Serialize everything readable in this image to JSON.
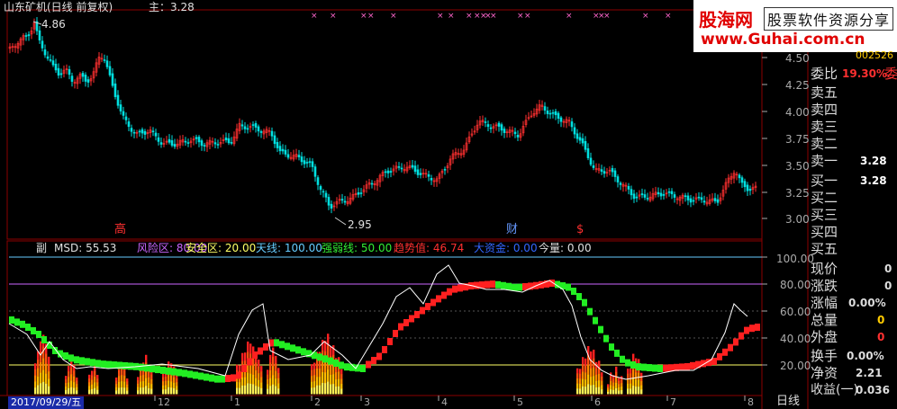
{
  "window": {
    "title": "山东矿机(日线 前复权)",
    "main_label": "主：3.28"
  },
  "price_chart": {
    "high_label": "4.86",
    "low_label": "2.95",
    "y_ticks": [
      "4.50",
      "4.25",
      "4.00",
      "3.75",
      "3.50",
      "3.25",
      "3.00"
    ],
    "markers": [
      {
        "text": "高",
        "color": "#ff3030"
      },
      {
        "text": "财",
        "color": "#6699ff"
      },
      {
        "text": "$",
        "color": "#ff3030"
      }
    ]
  },
  "indicator": {
    "prefix": "副",
    "items": [
      {
        "label": "MSD: 55.53",
        "color": "#e0e0e0"
      },
      {
        "label": "风险区: 80.00",
        "color": "#cc66ff"
      },
      {
        "label": "安全区: 20.00",
        "color": "#ffff66"
      },
      {
        "label": "天线: 100.00",
        "color": "#66ccff"
      },
      {
        "label": "强弱线: 50.00",
        "color": "#33ee33"
      },
      {
        "label": "趋势值: 46.74",
        "color": "#ff3030"
      },
      {
        "label": "大资金: 0.00",
        "color": "#3366ff"
      },
      {
        "label": "今量: 0.00",
        "color": "#e0e0e0"
      }
    ],
    "y_ticks": [
      "100.00",
      "80.00",
      "60.00",
      "40.00",
      "20.00"
    ]
  },
  "x_axis": {
    "date_badge": "2017/09/29/五",
    "ticks": [
      "1",
      "12",
      "1",
      "2",
      "3",
      "4",
      "5",
      "6",
      "7",
      "8"
    ],
    "period": "日线"
  },
  "logo": {
    "name": "股海网",
    "slogan": "股票软件资源分享",
    "url": "www.Guhai.com.cn"
  },
  "quote_panel": {
    "code": "002526",
    "ratio_label": "委比",
    "ratio_value": "19.30%",
    "ratio_suffix": "委",
    "sells": [
      "卖五",
      "卖四",
      "卖三",
      "卖二",
      "卖一"
    ],
    "sell1_price": "3.28",
    "buys": [
      "买一",
      "买二",
      "买三",
      "买四",
      "买五"
    ],
    "buy1_price": "3.28",
    "stats": [
      {
        "label": "现价",
        "value": "0"
      },
      {
        "label": "涨跌",
        "value": "0"
      },
      {
        "label": "涨幅",
        "value": "0.00%"
      },
      {
        "label": "总量",
        "value": "0"
      },
      {
        "label": "外盘",
        "value": "0"
      },
      {
        "label": "换手",
        "value": "0.00%"
      },
      {
        "label": "净资",
        "value": "2.21"
      },
      {
        "label": "收益(一)",
        "value": "0.036"
      }
    ]
  },
  "colors": {
    "up": "#ff3030",
    "down": "#00e0e0",
    "grid": "#7a0000",
    "axis": "#aaaaaa"
  }
}
